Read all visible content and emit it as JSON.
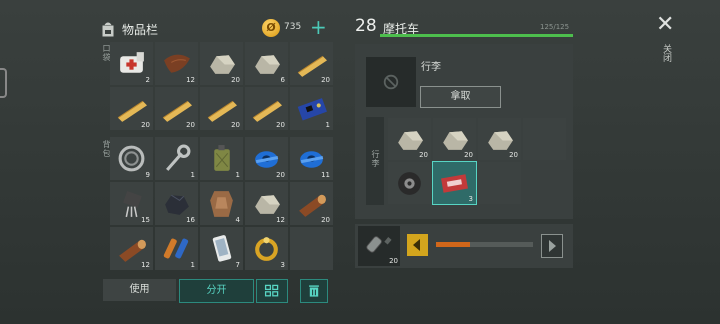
{
  "inventory": {
    "title": "物品栏",
    "coins": "735",
    "coin_symbol": "Ø",
    "plus": "+",
    "pocket_label": "口袋",
    "backpack_label": "背包",
    "pocket_items": [
      {
        "icon": "medkit-icon",
        "count": "2"
      },
      {
        "icon": "leather-icon",
        "count": "12"
      },
      {
        "icon": "stone-icon",
        "count": "20"
      },
      {
        "icon": "stone-icon",
        "count": "6"
      },
      {
        "icon": "plank-icon",
        "count": "20"
      },
      {
        "icon": "plank-icon",
        "count": "20"
      },
      {
        "icon": "plank-icon",
        "count": "20"
      },
      {
        "icon": "plank-icon",
        "count": "20"
      },
      {
        "icon": "plank-icon",
        "count": "20"
      },
      {
        "icon": "circuit-board-icon",
        "count": "1"
      }
    ],
    "backpack_items": [
      {
        "icon": "bearing-icon",
        "count": "9"
      },
      {
        "icon": "wrench-icon",
        "count": "1"
      },
      {
        "icon": "jerrycan-icon",
        "count": "1"
      },
      {
        "icon": "tape-icon",
        "count": "20"
      },
      {
        "icon": "tape-icon",
        "count": "11"
      },
      {
        "icon": "transistor-icon",
        "count": "15"
      },
      {
        "icon": "coal-icon",
        "count": "16"
      },
      {
        "icon": "hide-icon",
        "count": "4"
      },
      {
        "icon": "stone-icon",
        "count": "12"
      },
      {
        "icon": "log-icon",
        "count": "20"
      },
      {
        "icon": "log-icon",
        "count": "12"
      },
      {
        "icon": "battery-icon",
        "count": "1"
      },
      {
        "icon": "phone-icon",
        "count": "7"
      },
      {
        "icon": "gold-ring-icon",
        "count": "3"
      },
      {
        "icon": "empty",
        "count": ""
      }
    ]
  },
  "actions": {
    "use": "使用",
    "split": "分开",
    "sort_icon": "sort-icon",
    "delete_icon": "trash-icon"
  },
  "vehicle": {
    "level": "28",
    "name": "摩托车",
    "hp": "125/125",
    "hp_fraction": 1.0
  },
  "luggage": {
    "label": "行李",
    "button": "拿取",
    "side_label": "行李",
    "items": [
      {
        "icon": "stone-icon",
        "count": "20"
      },
      {
        "icon": "stone-icon",
        "count": "20"
      },
      {
        "icon": "stone-icon",
        "count": "20"
      },
      {
        "icon": "empty",
        "count": ""
      },
      {
        "icon": "tire-icon",
        "count": ""
      },
      {
        "icon": "ticket-icon",
        "count": "3",
        "selected": true
      },
      {
        "icon": "empty",
        "count": ""
      }
    ]
  },
  "fuel": {
    "icon": "gas-bottle-icon",
    "count": "20",
    "level_fraction": 0.35
  },
  "close": {
    "label": "关闭",
    "symbol": "✕"
  }
}
